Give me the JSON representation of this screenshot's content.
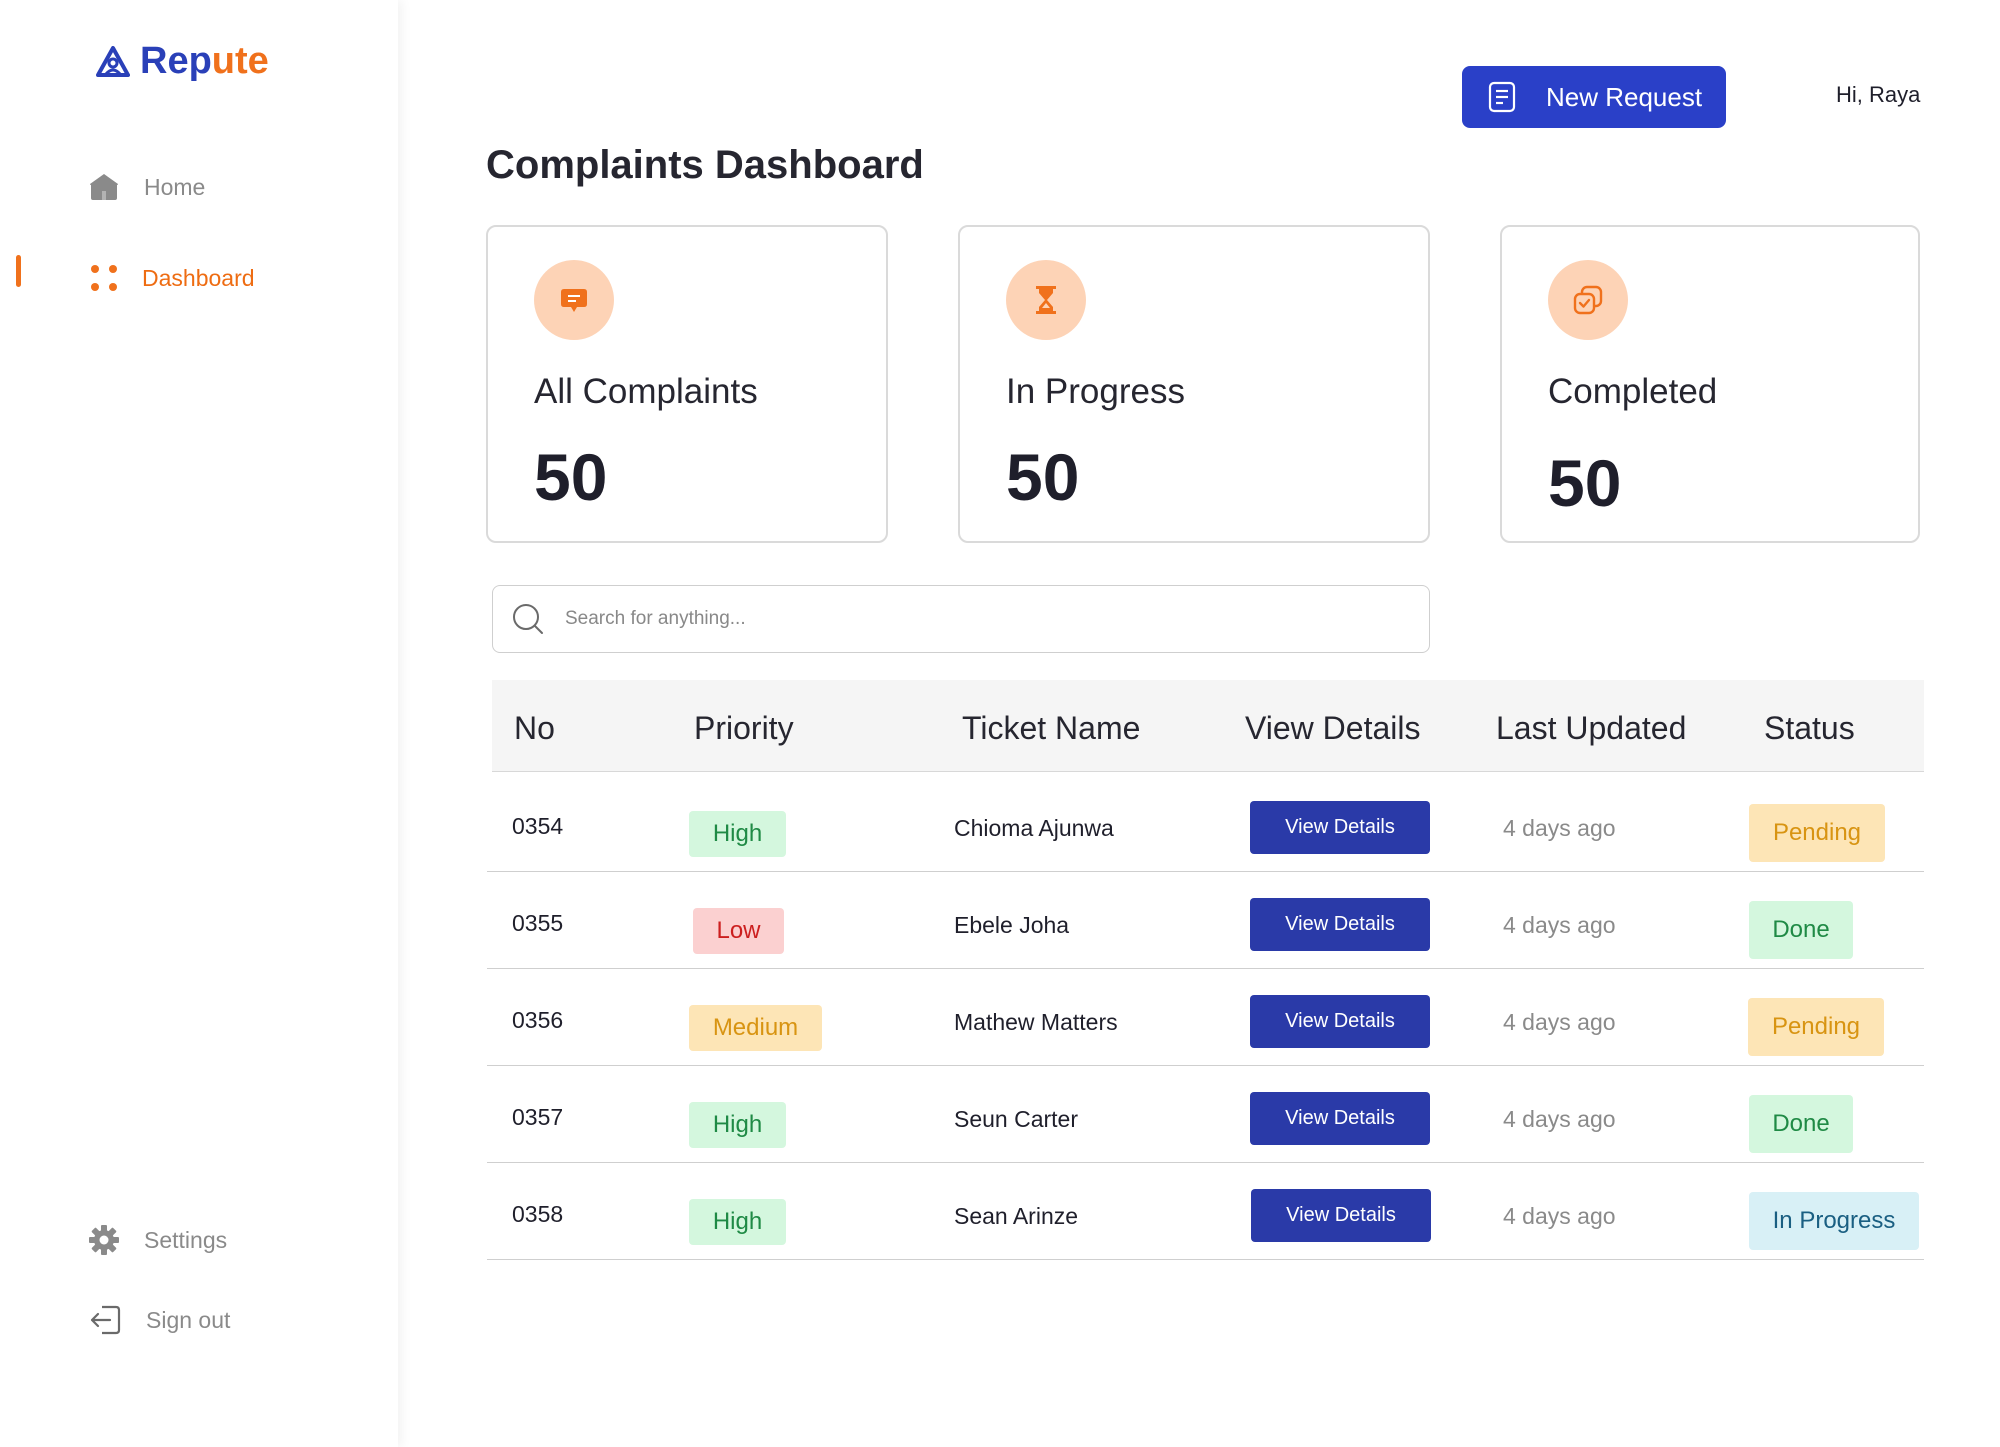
{
  "app": {
    "logo_part1": "Rep",
    "logo_part2": "ute",
    "greeting": "Hi, Raya",
    "new_request_label": "New Request"
  },
  "sidebar": {
    "items": [
      {
        "label": "Home",
        "icon": "home-icon"
      },
      {
        "label": "Dashboard",
        "icon": "dashboard-icon",
        "active": true
      }
    ],
    "bottom": [
      {
        "label": "Settings",
        "icon": "gear-icon"
      },
      {
        "label": "Sign out",
        "icon": "sign-out-icon"
      }
    ]
  },
  "main": {
    "title": "Complaints Dashboard",
    "cards": [
      {
        "label": "All Complaints",
        "value": "50",
        "icon": "chat-icon"
      },
      {
        "label": "In Progress",
        "value": "50",
        "icon": "hourglass-icon"
      },
      {
        "label": "Completed",
        "value": "50",
        "icon": "completed-icon"
      }
    ],
    "search_placeholder": "Search for anything..."
  },
  "table": {
    "headers": [
      "No",
      "Priority",
      "Ticket Name",
      "View Details",
      "Last Updated",
      "Status"
    ],
    "rows": [
      {
        "no": "0354",
        "priority": "High",
        "name": "Chioma Ajunwa",
        "action": "View Details",
        "updated": "4 days ago",
        "status": "Pending"
      },
      {
        "no": "0355",
        "priority": "Low",
        "name": "Ebele Joha",
        "action": "View Details",
        "updated": "4 days ago",
        "status": "Done"
      },
      {
        "no": "0356",
        "priority": "Medium",
        "name": "Mathew Matters",
        "action": "View Details",
        "updated": "4 days ago",
        "status": "Pending"
      },
      {
        "no": "0357",
        "priority": "High",
        "name": "Seun Carter",
        "action": "View Details",
        "updated": "4 days ago",
        "status": "Done"
      },
      {
        "no": "0358",
        "priority": "High",
        "name": "Sean Arinze",
        "action": "View Details",
        "updated": "4 days ago",
        "status": "In Progress"
      }
    ]
  },
  "colors": {
    "brand_blue": "#2a40c8",
    "brand_orange": "#f0711c",
    "badge_high": "#d4f7de",
    "badge_low": "#fbd0d0",
    "badge_medium": "#fde5b6",
    "badge_in_progress": "#d8f0f6"
  }
}
